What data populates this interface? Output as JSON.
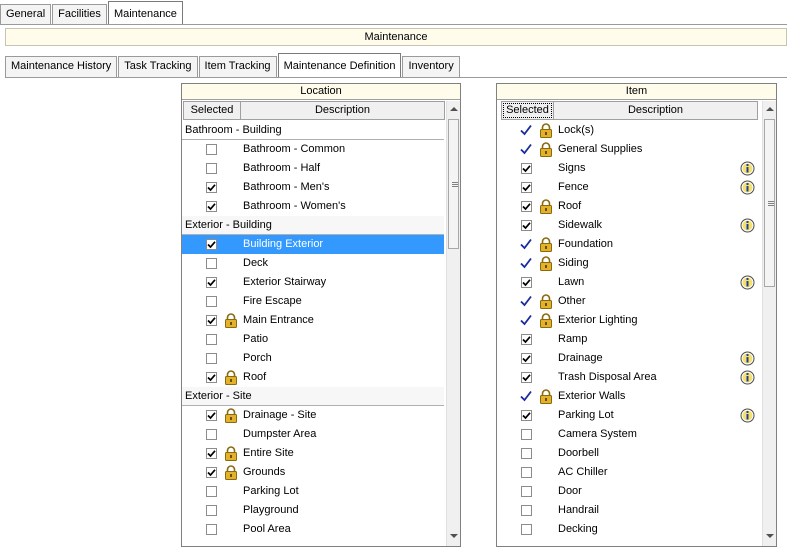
{
  "top_tabs": [
    {
      "label": "General",
      "active": false
    },
    {
      "label": "Facilities",
      "active": false
    },
    {
      "label": "Maintenance",
      "active": true
    }
  ],
  "section_title": "Maintenance",
  "sub_tabs": [
    {
      "label": "Maintenance History",
      "active": false
    },
    {
      "label": "Task Tracking",
      "active": false
    },
    {
      "label": "Item Tracking",
      "active": false
    },
    {
      "label": "Maintenance Definition",
      "active": true
    },
    {
      "label": "Inventory",
      "active": false
    }
  ],
  "location": {
    "title": "Location",
    "col_selected": "Selected",
    "col_description": "Description",
    "rows": [
      {
        "type": "group",
        "label": "Bathroom - Building"
      },
      {
        "type": "item",
        "label": "Bathroom - Common",
        "checked": false,
        "locked": false
      },
      {
        "type": "item",
        "label": "Bathroom - Half",
        "checked": false,
        "locked": false
      },
      {
        "type": "item",
        "label": "Bathroom - Men's",
        "checked": true,
        "locked": false
      },
      {
        "type": "item",
        "label": "Bathroom - Women's",
        "checked": true,
        "locked": false
      },
      {
        "type": "group",
        "label": "Exterior - Building"
      },
      {
        "type": "item",
        "label": "Building Exterior",
        "checked": true,
        "locked": false,
        "selected": true
      },
      {
        "type": "item",
        "label": "Deck",
        "checked": false,
        "locked": false
      },
      {
        "type": "item",
        "label": "Exterior Stairway",
        "checked": true,
        "locked": false
      },
      {
        "type": "item",
        "label": "Fire Escape",
        "checked": false,
        "locked": false
      },
      {
        "type": "item",
        "label": "Main Entrance",
        "checked": true,
        "locked": true
      },
      {
        "type": "item",
        "label": "Patio",
        "checked": false,
        "locked": false
      },
      {
        "type": "item",
        "label": "Porch",
        "checked": false,
        "locked": false
      },
      {
        "type": "item",
        "label": "Roof",
        "checked": true,
        "locked": true
      },
      {
        "type": "group",
        "label": "Exterior - Site"
      },
      {
        "type": "item",
        "label": "Drainage - Site",
        "checked": true,
        "locked": true
      },
      {
        "type": "item",
        "label": "Dumpster Area",
        "checked": false,
        "locked": false
      },
      {
        "type": "item",
        "label": "Entire Site",
        "checked": true,
        "locked": true
      },
      {
        "type": "item",
        "label": "Grounds",
        "checked": true,
        "locked": true
      },
      {
        "type": "item",
        "label": "Parking Lot",
        "checked": false,
        "locked": false
      },
      {
        "type": "item",
        "label": "Playground",
        "checked": false,
        "locked": false
      },
      {
        "type": "item",
        "label": "Pool Area",
        "checked": false,
        "locked": false
      }
    ]
  },
  "item": {
    "title": "Item",
    "col_selected": "Selected",
    "col_description": "Description",
    "rows": [
      {
        "label": "Lock(s)",
        "state": "fixed",
        "locked": true,
        "info": false
      },
      {
        "label": "General Supplies",
        "state": "fixed",
        "locked": true,
        "info": false
      },
      {
        "label": "Signs",
        "state": "checked",
        "locked": false,
        "info": true
      },
      {
        "label": "Fence",
        "state": "checked",
        "locked": false,
        "info": true
      },
      {
        "label": "Roof",
        "state": "checked",
        "locked": true,
        "info": false
      },
      {
        "label": "Sidewalk",
        "state": "checked",
        "locked": false,
        "info": true
      },
      {
        "label": "Foundation",
        "state": "fixed",
        "locked": true,
        "info": false
      },
      {
        "label": "Siding",
        "state": "fixed",
        "locked": true,
        "info": false
      },
      {
        "label": "Lawn",
        "state": "checked",
        "locked": false,
        "info": true
      },
      {
        "label": "Other",
        "state": "fixed",
        "locked": true,
        "info": false
      },
      {
        "label": "Exterior Lighting",
        "state": "fixed",
        "locked": true,
        "info": false
      },
      {
        "label": "Ramp",
        "state": "checked",
        "locked": false,
        "info": false
      },
      {
        "label": "Drainage",
        "state": "checked",
        "locked": false,
        "info": true
      },
      {
        "label": "Trash Disposal Area",
        "state": "checked",
        "locked": false,
        "info": true
      },
      {
        "label": "Exterior Walls",
        "state": "fixed",
        "locked": true,
        "info": false
      },
      {
        "label": "Parking Lot",
        "state": "checked",
        "locked": false,
        "info": true
      },
      {
        "label": "Camera System",
        "state": "unchecked",
        "locked": false,
        "info": false
      },
      {
        "label": "Doorbell",
        "state": "unchecked",
        "locked": false,
        "info": false
      },
      {
        "label": "AC Chiller",
        "state": "unchecked",
        "locked": false,
        "info": false
      },
      {
        "label": "Door",
        "state": "unchecked",
        "locked": false,
        "info": false
      },
      {
        "label": "Handrail",
        "state": "unchecked",
        "locked": false,
        "info": false
      },
      {
        "label": "Decking",
        "state": "unchecked",
        "locked": false,
        "info": false
      }
    ]
  },
  "icons": {
    "lock": "lock-icon",
    "info": "info-icon",
    "check": "checkmark-icon"
  },
  "colors": {
    "selection": "#3399ff",
    "fixed_check": "#1a2b9a",
    "lock_gold": "#d8a520",
    "banner": "#fffcec"
  }
}
